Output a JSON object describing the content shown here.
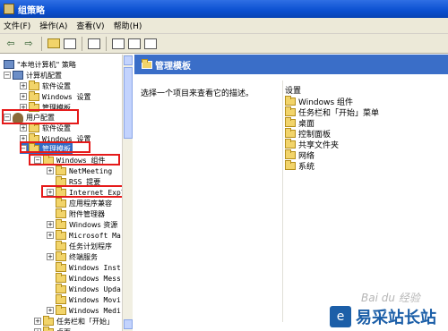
{
  "window": {
    "title": "组策略"
  },
  "menu": {
    "items": [
      "文件(F)",
      "操作(A)",
      "查看(V)",
      "帮助(H)"
    ]
  },
  "toolbar": {
    "back": "⇦",
    "forward": "⇨"
  },
  "tree": {
    "nodes": [
      {
        "label": "\"本地计算机\" 策略"
      },
      {
        "label": "计算机配置"
      },
      {
        "label": "软件设置"
      },
      {
        "label": "Windows 设置"
      },
      {
        "label": "管理模板"
      },
      {
        "label": "用户配置"
      },
      {
        "label": "软件设置"
      },
      {
        "label": "Windows 设置"
      },
      {
        "label": "管理模板"
      },
      {
        "label": "Windows 组件"
      },
      {
        "label": "NetMeeting"
      },
      {
        "label": "RSS 提要"
      },
      {
        "label": "Internet Explorer"
      },
      {
        "label": "应用程序兼容"
      },
      {
        "label": "Windows 资源"
      },
      {
        "label": "Microsoft Ma"
      },
      {
        "label": "任务计划程序"
      },
      {
        "label": "终端服务"
      },
      {
        "label": "Windows Inst"
      },
      {
        "label": "Windows Mess"
      },
      {
        "label": "Windows Upda"
      },
      {
        "label": "Windows Movi"
      },
      {
        "label": "Windows Medi"
      },
      {
        "label": "任务栏和「开始」"
      },
      {
        "label": "桌面"
      }
    ]
  },
  "right": {
    "header": "管理模板",
    "description": "选择一个项目来查看它的描述。",
    "column_header": "设置",
    "items": [
      "Windows 组件",
      "任务栏和「开始」菜单",
      "桌面",
      "控制面板",
      "共享文件夹",
      "网络",
      "系统"
    ]
  },
  "watermark": {
    "site": "易采站长站",
    "baidu": "Bai du 经验"
  }
}
